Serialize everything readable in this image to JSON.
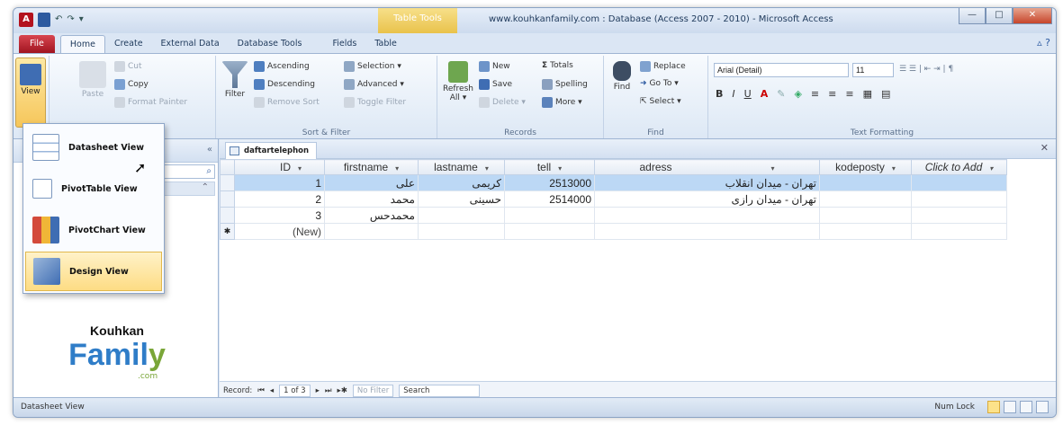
{
  "window": {
    "title": "www.kouhkanfamily.com : Database (Access 2007 - 2010)  -  Microsoft Access",
    "contextual_tab": "Table Tools",
    "controls": {
      "minimize": "—",
      "maximize": "□",
      "close": "✕"
    }
  },
  "tabs": [
    "File",
    "Home",
    "Create",
    "External Data",
    "Database Tools",
    "Fields",
    "Table"
  ],
  "active_tab": "Home",
  "ribbon": {
    "views": {
      "view_label": "View"
    },
    "clipboard": {
      "paste": "Paste",
      "cut": "Cut",
      "copy": "Copy",
      "format_painter": "Format Painter"
    },
    "sort_filter": {
      "filter": "Filter",
      "ascending": "Ascending",
      "descending": "Descending",
      "remove_sort": "Remove Sort",
      "selection": "Selection ▾",
      "advanced": "Advanced ▾",
      "toggle_filter": "Toggle Filter",
      "label": "Sort & Filter"
    },
    "records": {
      "refresh": "Refresh All ▾",
      "new": "New",
      "save": "Save",
      "delete": "Delete ▾",
      "totals": "Totals",
      "spelling": "Spelling",
      "more": "More ▾",
      "label": "Records"
    },
    "find": {
      "find": "Find",
      "replace": "Replace",
      "goto": "Go To ▾",
      "select": "Select ▾",
      "label": "Find"
    },
    "text_formatting": {
      "font": "Arial (Detail)",
      "size": "11",
      "label": "Text Formatting"
    }
  },
  "view_menu": {
    "items": [
      {
        "label": "Datasheet View"
      },
      {
        "label": "PivotTable View"
      },
      {
        "label": "PivotChart View"
      },
      {
        "label": "Design View"
      }
    ]
  },
  "nav_pane": {
    "collapse": "«",
    "search_icon": "⌕"
  },
  "logo": {
    "line1": "Kouhkan",
    "line2a": "Famil",
    "line2b": "y",
    "line3": ".com"
  },
  "document": {
    "tab_label": "daftartelephon",
    "columns": [
      "ID",
      "firstname",
      "lastname",
      "tell",
      "adress",
      "kodeposty",
      "Click to Add"
    ],
    "rows": [
      {
        "id": "1",
        "firstname": "علی",
        "lastname": "کریمی",
        "tell": "2513000",
        "adress": "تهران - میدان انقلاب",
        "kodeposty": ""
      },
      {
        "id": "2",
        "firstname": "محمد",
        "lastname": "حسینی",
        "tell": "2514000",
        "adress": "تهران - میدان رازی",
        "kodeposty": ""
      },
      {
        "id": "3",
        "firstname": "محمدحس",
        "lastname": "",
        "tell": "",
        "adress": "",
        "kodeposty": ""
      }
    ],
    "new_row": "(New)",
    "record_nav": {
      "label": "Record:",
      "position": "1 of 3",
      "filter": "No Filter",
      "search": "Search"
    }
  },
  "status": {
    "left": "Datasheet View",
    "right": "Num Lock"
  },
  "colors": {
    "accent": "#2c5aa0",
    "selected_row": "#bcd8f5",
    "menu_highlight": "#fddc84"
  }
}
